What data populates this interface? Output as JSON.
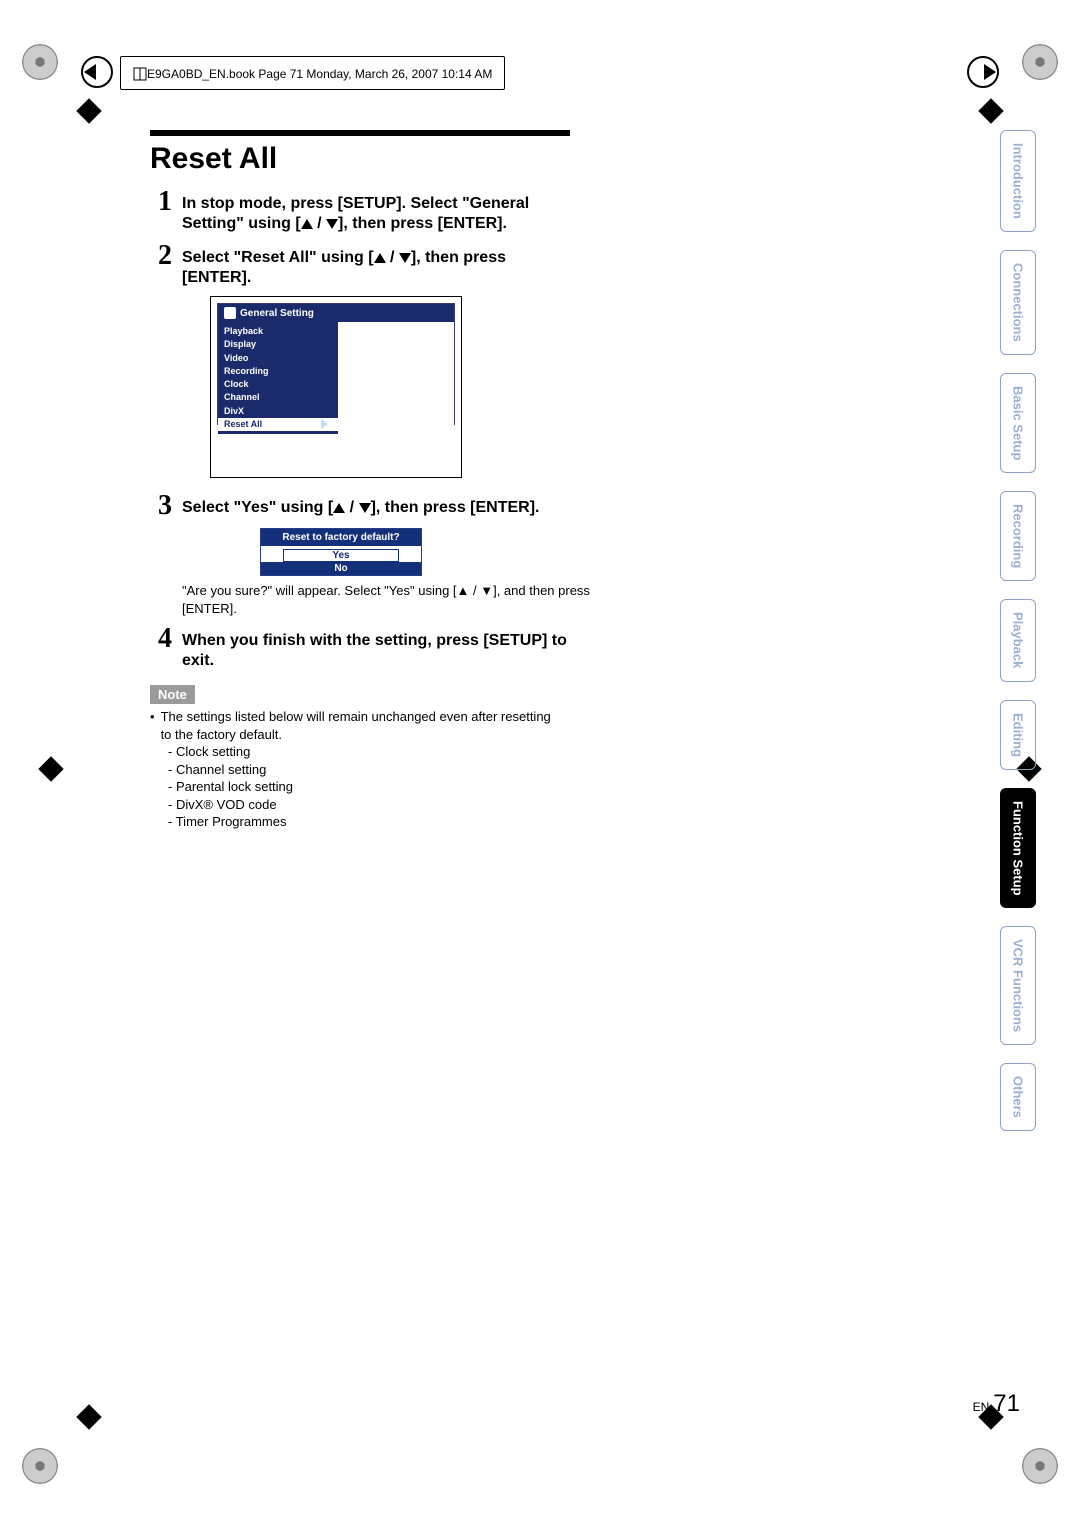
{
  "header_runner": "E9GA0BD_EN.book  Page 71  Monday, March 26, 2007  10:14 AM",
  "section_title": "Reset All",
  "steps": [
    {
      "num": "1",
      "text_parts": [
        "In stop mode, press [SETUP]. Select \"General Setting\" using [",
        "UP",
        " / ",
        "DOWN",
        "], then press [ENTER]."
      ]
    },
    {
      "num": "2",
      "text_parts": [
        "Select \"Reset All\" using [",
        "UP",
        " / ",
        "DOWN",
        "], then press [ENTER]."
      ]
    },
    {
      "num": "3",
      "text_parts": [
        "Select \"Yes\" using [",
        "UP",
        " / ",
        "DOWN",
        "], then press [ENTER]."
      ]
    },
    {
      "num": "4",
      "text_plain": "When you finish with the setting, press [SETUP] to exit."
    }
  ],
  "menu": {
    "title": "General Setting",
    "items": [
      "Playback",
      "Display",
      "Video",
      "Recording",
      "Clock",
      "Channel",
      "DivX",
      "Reset All"
    ],
    "selected": "Reset All"
  },
  "dialog": {
    "title": "Reset to factory default?",
    "options": [
      "Yes",
      "No"
    ],
    "selected": "Yes"
  },
  "post_dialog_note": "\"Are you sure?\" will appear. Select \"Yes\" using [▲ / ▼], and then press [ENTER].",
  "note_label": "Note",
  "note_intro": "The settings listed below will remain unchanged even after resetting to the factory default.",
  "note_items": [
    "Clock setting",
    "Channel setting",
    "Parental lock setting",
    "DivX® VOD code",
    "Timer Programmes"
  ],
  "side_tabs": [
    "Introduction",
    "Connections",
    "Basic Setup",
    "Recording",
    "Playback",
    "Editing",
    "Function Setup",
    "VCR Functions",
    "Others"
  ],
  "active_tab": "Function Setup",
  "page_label_small": "EN",
  "page_number": "71"
}
